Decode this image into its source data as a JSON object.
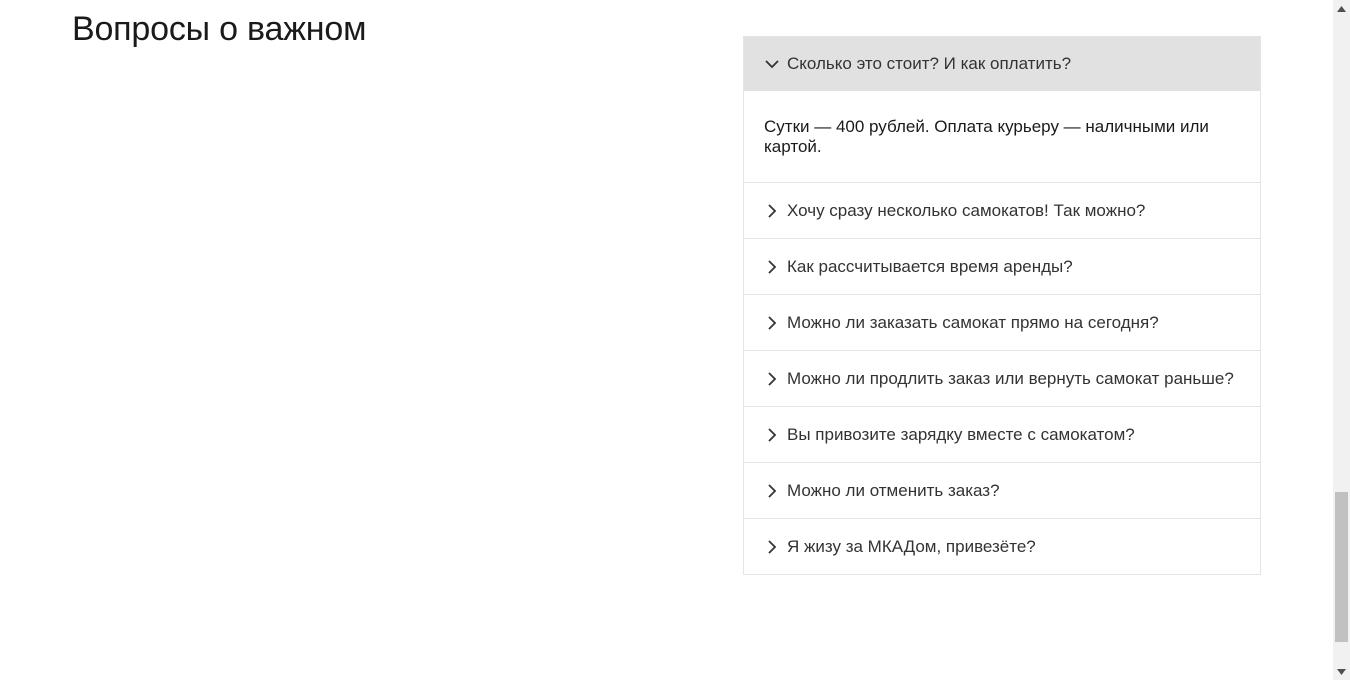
{
  "section": {
    "title": "Вопросы о важном"
  },
  "faq": {
    "items": [
      {
        "question": "Сколько это стоит? И как оплатить?",
        "expanded": true,
        "answer": "Сутки — 400 рублей. Оплата курьеру — наличными или картой."
      },
      {
        "question": "Хочу сразу несколько самокатов! Так можно?",
        "expanded": false
      },
      {
        "question": "Как рассчитывается время аренды?",
        "expanded": false
      },
      {
        "question": "Можно ли заказать самокат прямо на сегодня?",
        "expanded": false
      },
      {
        "question": "Можно ли продлить заказ или вернуть самокат раньше?",
        "expanded": false
      },
      {
        "question": "Вы привозите зарядку вместе с самокатом?",
        "expanded": false
      },
      {
        "question": "Можно ли отменить заказ?",
        "expanded": false
      },
      {
        "question": "Я жизу за МКАДом, привезёте?",
        "expanded": false
      }
    ]
  },
  "icons": {
    "expanded": "chevron-down-icon",
    "collapsed": "chevron-right-icon"
  },
  "colors": {
    "open_heading_bg": "#e1e1e1",
    "border": "#e4e4e4",
    "text": "#333333",
    "scrollbar_track": "#f1f1f1",
    "scrollbar_thumb": "#c1c1c1"
  },
  "scrollbar": {
    "scroll_position": 0.85
  }
}
